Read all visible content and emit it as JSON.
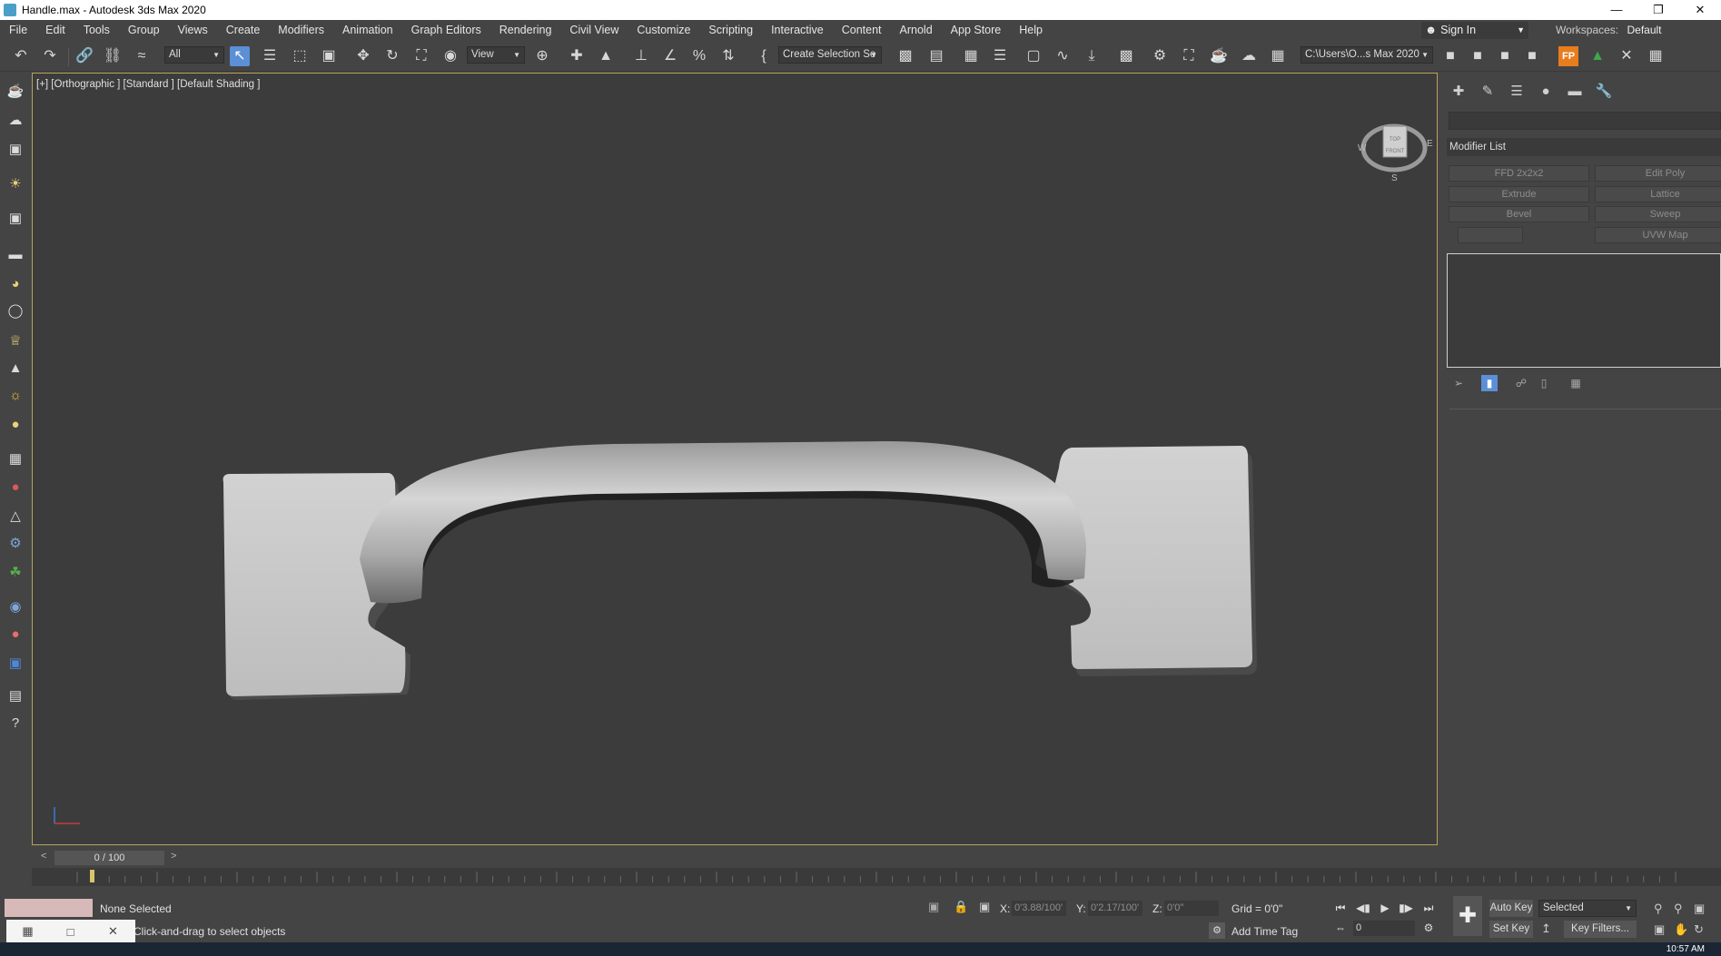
{
  "window": {
    "title": "Handle.max - Autodesk 3ds Max 2020",
    "minimize_icon": "minimize-icon",
    "restore_icon": "restore-icon",
    "close_icon": "close-icon"
  },
  "menu": [
    "File",
    "Edit",
    "Tools",
    "Group",
    "Views",
    "Create",
    "Modifiers",
    "Animation",
    "Graph Editors",
    "Rendering",
    "Civil View",
    "Customize",
    "Scripting",
    "Interactive",
    "Content",
    "Arnold",
    "App Store",
    "Help"
  ],
  "account": {
    "sign_in": "Sign In",
    "workspaces_label": "Workspaces:",
    "workspace_value": "Default"
  },
  "toolbar": {
    "selection_filter": "All",
    "reference_coord": "View",
    "named_selection_placeholder": "Create Selection Se",
    "project_path": "C:\\Users\\O...s Max 2020"
  },
  "viewport": {
    "label": "[+] [Orthographic ] [Standard ] [Default Shading ]",
    "viewcube_top": "TOP",
    "viewcube_front": "FRONT",
    "compass_w": "W",
    "compass_e": "E",
    "compass_s": "S",
    "background": "#3c3c3c",
    "border_color": "#b8a25c",
    "model_color": "#c8c8c8"
  },
  "command_panel": {
    "modifier_list": "Modifier List",
    "modifiers": [
      "FFD 2x2x2",
      "Edit Poly",
      "Extrude",
      "Lattice",
      "Bevel",
      "Sweep",
      "",
      "UVW Map"
    ]
  },
  "timeline": {
    "frame": "0 / 100",
    "prev": "<",
    "next": ">"
  },
  "status": {
    "selection": "None Selected",
    "prompt": "Click-and-drag to select objects",
    "x_label": "X:",
    "x_value": "0'3.88/100'",
    "y_label": "Y:",
    "y_value": "0'2.17/100'",
    "z_label": "Z:",
    "z_value": "0'0\"",
    "grid": "Grid = 0'0\"",
    "add_time_tag": "Add Time Tag",
    "auto_key": "Auto Key",
    "set_key": "Set Key",
    "key_mode": "Selected",
    "key_filters": "Key Filters...",
    "current_frame": "0"
  },
  "taskbar": {
    "clock": "10:57 AM"
  }
}
